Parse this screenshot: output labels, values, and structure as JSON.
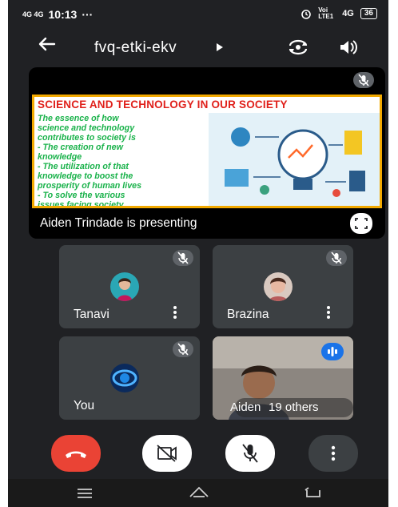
{
  "status_bar": {
    "signal": "4G 4G",
    "time": "10:13",
    "dots": "···",
    "volte": "Voi LTE1",
    "net": "4G",
    "battery": "36"
  },
  "header": {
    "meeting_code": "fvq-etki-ekv"
  },
  "presentation": {
    "slide_title": "SCIENCE AND TECHNOLOGY IN OUR SOCIETY",
    "slide_text": "The essence of how\nscience and technology\ncontributes to society is\n- The creation of new\n  knowledge\n- The utilization of that\n  knowledge to boost the\n  prosperity of human lives\n-  To solve the various\n  issues facing society.",
    "presenter_label": "Aiden Trindade is presenting"
  },
  "participants": [
    {
      "name": "Tanavi"
    },
    {
      "name": "Brazina"
    },
    {
      "name": "You"
    }
  ],
  "overflow_tile": {
    "name": "Aiden",
    "others": "19 others"
  },
  "colors": {
    "background": "#202124",
    "tile": "#3c4043",
    "end_call": "#ea4335",
    "slide_title": "#e0201b",
    "slide_text": "#19b24a",
    "speaking": "#1a73e8"
  }
}
